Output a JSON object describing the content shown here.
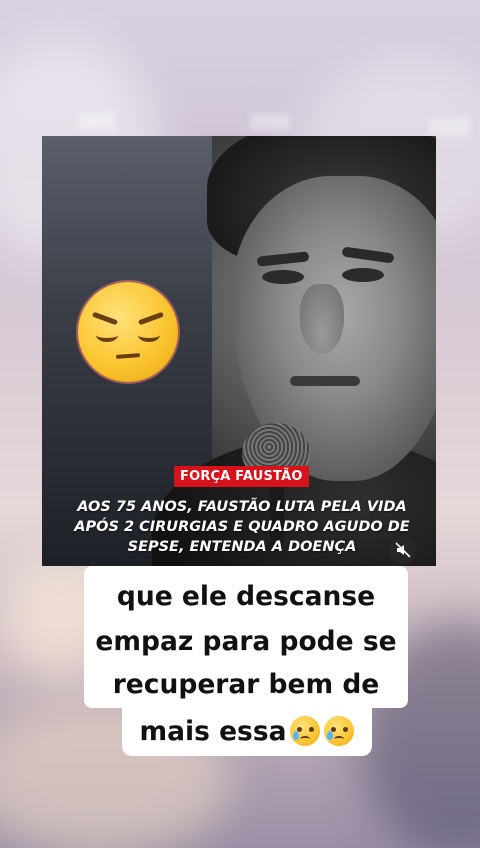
{
  "post": {
    "tag": "FORÇA FAUSTÃO",
    "headline_lines": [
      "AOS 75 ANOS, FAUSTÃO LUTA PELA VIDA",
      "APÓS 2 CIRURGIAS E QUADRO AGUDO DE",
      "SEPSE, ENTENDA A DOENÇA"
    ],
    "emoji_overlay": "pensive-face"
  },
  "caption": {
    "lines": [
      "que ele descanse",
      "empaz para pode se",
      "recuperar bem de",
      "mais essa"
    ],
    "trailing_emojis": [
      "face-holding-back-tears",
      "face-holding-back-tears"
    ]
  },
  "controls": {
    "mute_icon": "muted-speaker-icon"
  },
  "colors": {
    "tag_bg": "#d6131a",
    "caption_bg": "#ffffff",
    "caption_text": "#111111"
  }
}
